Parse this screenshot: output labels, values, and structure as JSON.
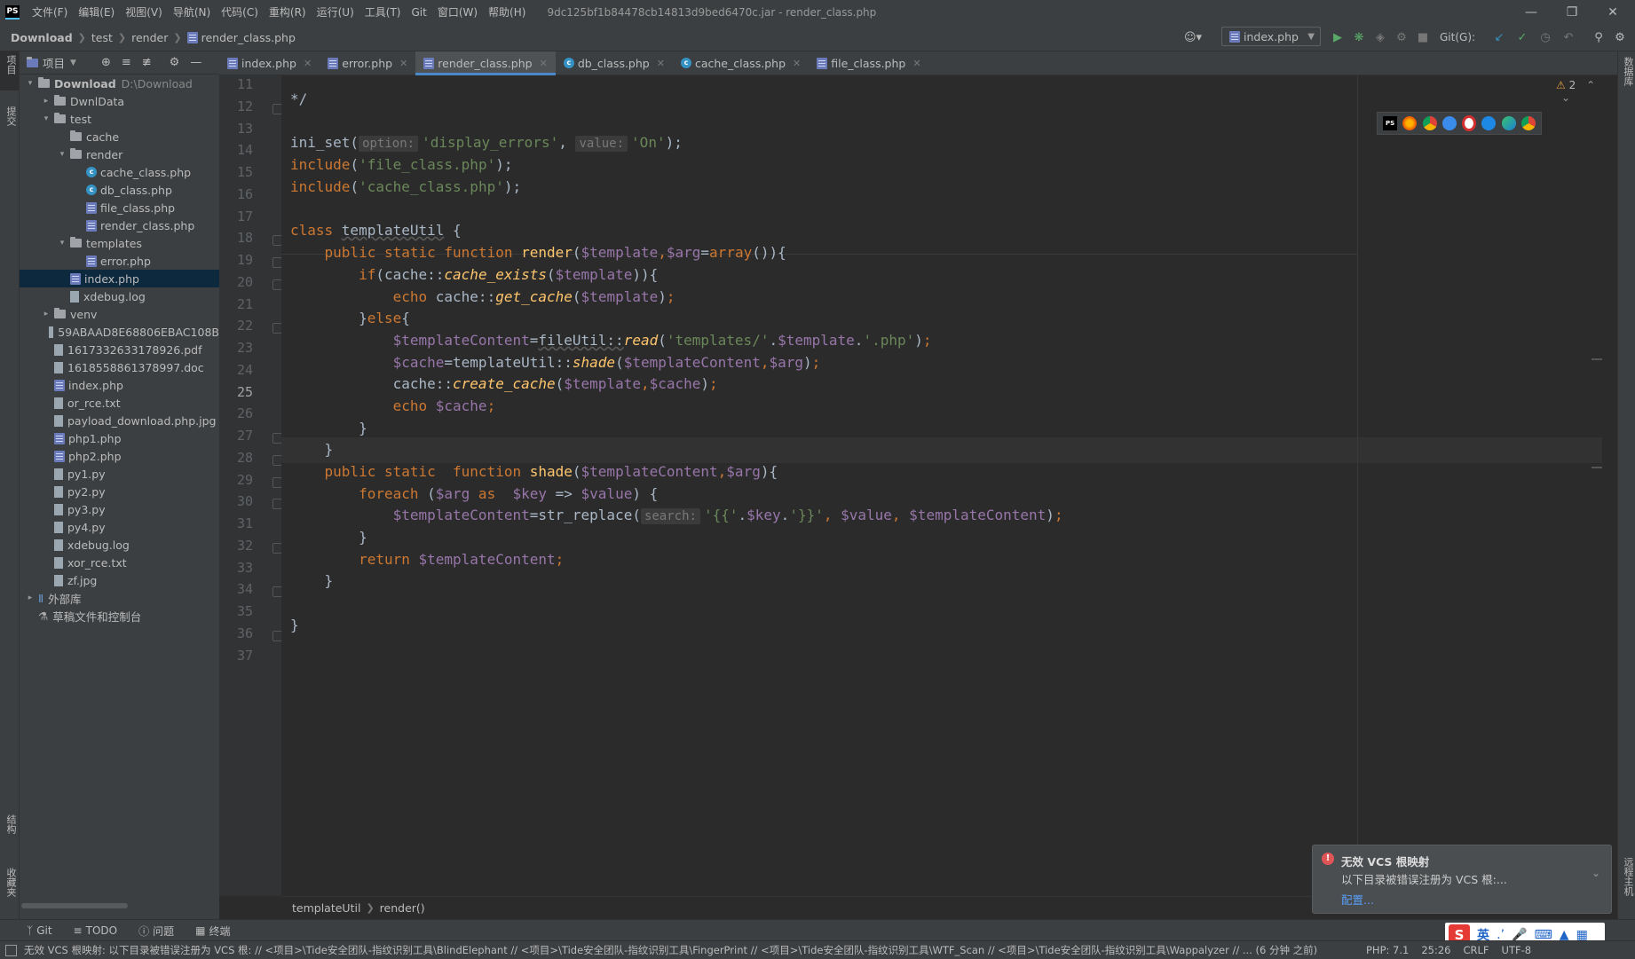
{
  "app": {
    "icon_text": "PS",
    "window_title": "9dc125bf1b84478cb14813d9bed6470c.jar - render_class.php"
  },
  "menu": [
    "文件(F)",
    "编辑(E)",
    "视图(V)",
    "导航(N)",
    "代码(C)",
    "重构(R)",
    "运行(U)",
    "工具(T)",
    "Git",
    "窗口(W)",
    "帮助(H)"
  ],
  "navbar": {
    "breadcrumb": [
      "Download",
      "test",
      "render",
      "render_class.php"
    ],
    "run_config": "index.php",
    "git_label": "Git(G):"
  },
  "project_panel": {
    "title": "项目",
    "tree": [
      {
        "label": "Download",
        "extra": "D:\\Download",
        "type": "folder",
        "level": 0,
        "expanded": true
      },
      {
        "label": "DwnlData",
        "type": "folder",
        "level": 1,
        "expanded": false
      },
      {
        "label": "test",
        "type": "folder",
        "level": 1,
        "expanded": true
      },
      {
        "label": "cache",
        "type": "folder",
        "level": 2,
        "expanded": null
      },
      {
        "label": "render",
        "type": "folder",
        "level": 2,
        "expanded": true
      },
      {
        "label": "cache_class.php",
        "type": "class",
        "level": 3
      },
      {
        "label": "db_class.php",
        "type": "class",
        "level": 3
      },
      {
        "label": "file_class.php",
        "type": "php",
        "level": 3
      },
      {
        "label": "render_class.php",
        "type": "php",
        "level": 3
      },
      {
        "label": "templates",
        "type": "folder",
        "level": 2,
        "expanded": true
      },
      {
        "label": "error.php",
        "type": "php",
        "level": 3
      },
      {
        "label": "index.php",
        "type": "php",
        "level": 2,
        "selected": true
      },
      {
        "label": "xdebug.log",
        "type": "file",
        "level": 2
      },
      {
        "label": "venv",
        "type": "folder",
        "level": 1,
        "expanded": false
      },
      {
        "label": "59ABAAD8E68806EBAC108B",
        "type": "file",
        "level": 1
      },
      {
        "label": "1617332633178926.pdf",
        "type": "file",
        "level": 1
      },
      {
        "label": "1618558861378997.doc",
        "type": "file",
        "level": 1
      },
      {
        "label": "index.php",
        "type": "php",
        "level": 1
      },
      {
        "label": "or_rce.txt",
        "type": "file",
        "level": 1
      },
      {
        "label": "payload_download.php.jpg",
        "type": "file",
        "level": 1
      },
      {
        "label": "php1.php",
        "type": "php",
        "level": 1
      },
      {
        "label": "php2.php",
        "type": "php",
        "level": 1
      },
      {
        "label": "py1.py",
        "type": "file",
        "level": 1
      },
      {
        "label": "py2.py",
        "type": "file",
        "level": 1
      },
      {
        "label": "py3.py",
        "type": "file",
        "level": 1
      },
      {
        "label": "py4.py",
        "type": "file",
        "level": 1
      },
      {
        "label": "xdebug.log",
        "type": "file",
        "level": 1
      },
      {
        "label": "xor_rce.txt",
        "type": "file",
        "level": 1
      },
      {
        "label": "zf.jpg",
        "type": "file",
        "level": 1
      },
      {
        "label": "外部库",
        "type": "lib",
        "level": 0,
        "expanded": false
      },
      {
        "label": "草稿文件和控制台",
        "type": "scratch",
        "level": 0
      }
    ]
  },
  "tabs": [
    {
      "label": "index.php",
      "icon": "php"
    },
    {
      "label": "error.php",
      "icon": "php"
    },
    {
      "label": "render_class.php",
      "icon": "php",
      "active": true
    },
    {
      "label": "db_class.php",
      "icon": "class"
    },
    {
      "label": "cache_class.php",
      "icon": "class"
    },
    {
      "label": "file_class.php",
      "icon": "php"
    }
  ],
  "editor": {
    "warnings": "2",
    "current_line": 25,
    "line_numbers": [
      "11",
      "12",
      "13",
      "14",
      "15",
      "16",
      "17",
      "18",
      "19",
      "20",
      "21",
      "22",
      "23",
      "24",
      "25",
      "26",
      "27",
      "28",
      "29",
      "30",
      "31",
      "32",
      "33",
      "34",
      "35",
      "36",
      "37"
    ],
    "code": {
      "l12": "*/",
      "l14_fn": "ini_set(",
      "l14_hint1": "option:",
      "l14_str1": "'display_errors'",
      "l14_comma": ", ",
      "l14_hint2": "value:",
      "l14_str2": "'On'",
      "l14_end": ");",
      "l15_kw": "include",
      "l15_str": "'file_class.php'",
      "l16_kw": "include",
      "l16_str": "'cache_class.php'",
      "l18_kw": "class ",
      "l18_name": "templateUtil",
      "l18_end": " {",
      "l19_kw": "public static function ",
      "l19_fn": "render",
      "l19_v1": "$template",
      "l19_v2": "$arg",
      "l19_kw2": "array",
      "l20_kw": "if",
      "l20_cls": "cache::",
      "l20_fn": "cache_exists",
      "l20_v": "$template",
      "l21_kw": "echo ",
      "l21_cls": "cache::",
      "l21_fn": "get_cache",
      "l21_v": "$template",
      "l22_kw": "else",
      "l23_v1": "$templateContent",
      "l23_cls": "fileUtil::",
      "l23_fn": "read",
      "l23_s1": "'templates/'",
      "l23_v2": "$template",
      "l23_s2": "'.php'",
      "l24_v1": "$cache",
      "l24_cls": "templateUtil::",
      "l24_fn": "shade",
      "l24_v2": "$templateContent",
      "l24_v3": "$arg",
      "l25_cls": "cache::",
      "l25_fn": "create_cache",
      "l25_v1": "$template",
      "l25_v2": "$cache",
      "l26_kw": "echo ",
      "l26_v": "$cache",
      "l29_kw": "public static  function ",
      "l29_fn": "shade",
      "l29_v1": "$templateContent",
      "l29_v2": "$arg",
      "l30_kw": "foreach ",
      "l30_v1": "$arg",
      "l30_kw2": " as ",
      "l30_v2": "$key",
      "l30_v3": "$value",
      "l31_v1": "$templateContent",
      "l31_fn": "str_replace(",
      "l31_hint": "search:",
      "l31_s1": "'{{'",
      "l31_v2": "$key",
      "l31_s2": "'}}'",
      "l31_v3": "$value",
      "l31_v4": "$templateContent",
      "l33_kw": "return ",
      "l33_v": "$templateContent"
    }
  },
  "editor_breadcrumb": [
    "templateUtil",
    "render()"
  ],
  "bottom_tools": [
    "Git",
    "TODO",
    "问题",
    "终端"
  ],
  "left_strip": [
    "项目",
    "提交",
    "结构",
    "收藏夹"
  ],
  "right_strip": [
    "数据库",
    "远程主机"
  ],
  "notification": {
    "title": "无效 VCS 根映射",
    "body": "以下目录被错误注册为 VCS 根:...",
    "link": "配置..."
  },
  "status": {
    "message": "无效 VCS 根映射: 以下目录被错误注册为 VCS 根: // <项目>\\Tide安全团队-指纹识别工具\\BlindElephant // <项目>\\Tide安全团队-指纹识别工具\\FingerPrint // <项目>\\Tide安全团队-指纹识别工具\\WTF_Scan // <项目>\\Tide安全团队-指纹识别工具\\Wappalyzer // ... (6 分钟 之前)",
    "php": "PHP: 7.1",
    "position": "25:26",
    "line_sep": "CRLF",
    "encoding": "UTF-8"
  },
  "ime": {
    "lang": "英"
  },
  "colors": {
    "accent": "#4a88c7",
    "selection": "#0d293e",
    "keyword": "#cc7832",
    "string": "#6a8759",
    "variable": "#9876aa",
    "function": "#ffc66d",
    "error": "#e05555"
  }
}
